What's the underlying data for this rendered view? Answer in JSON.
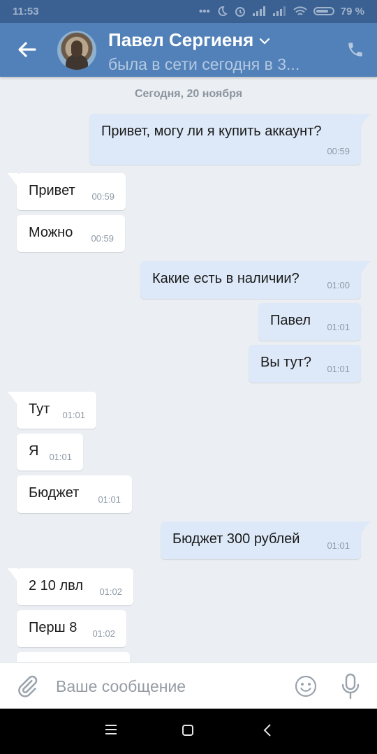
{
  "status_bar": {
    "time": "11:53",
    "battery": "79 %",
    "battery_level": 0.79
  },
  "header": {
    "contact_name": "Павел Сергиеня",
    "subtitle": "была в сети сегодня в 3..."
  },
  "conversation": {
    "date_separator": "Сегодня, 20 ноября",
    "messages": [
      {
        "direction": "out",
        "text": "Привет, могу ли я купить аккаунт?",
        "time": "00:59"
      },
      {
        "direction": "in",
        "text": "Привет",
        "time": "00:59"
      },
      {
        "direction": "in",
        "text": "Можно",
        "time": "00:59"
      },
      {
        "direction": "out",
        "text": "Какие есть в наличии?",
        "time": "01:00"
      },
      {
        "direction": "out",
        "text": "Павел",
        "time": "01:01"
      },
      {
        "direction": "out",
        "text": "Вы тут?",
        "time": "01:01"
      },
      {
        "direction": "in",
        "text": "Тут",
        "time": "01:01"
      },
      {
        "direction": "in",
        "text": "Я",
        "time": "01:01"
      },
      {
        "direction": "in",
        "text": "Бюджет",
        "time": "01:01"
      },
      {
        "direction": "out",
        "text": "Бюджет 300 рублей",
        "time": "01:01"
      },
      {
        "direction": "in",
        "text": "2 10 лвл",
        "time": "01:02"
      },
      {
        "direction": "in",
        "text": "Перш 8",
        "time": "01:02"
      }
    ]
  },
  "composer": {
    "placeholder": "Ваше сообщение"
  },
  "colors": {
    "header": "#5181b8",
    "status_bar": "#3b6192",
    "incoming_bubble": "#ffffff",
    "outgoing_bubble": "#dde9f8",
    "background": "#ebeef2"
  },
  "icons": {
    "back": "arrow-left-icon",
    "call": "phone-icon",
    "attach": "paperclip-icon",
    "emoji": "smiley-icon",
    "mic": "microphone-icon"
  }
}
